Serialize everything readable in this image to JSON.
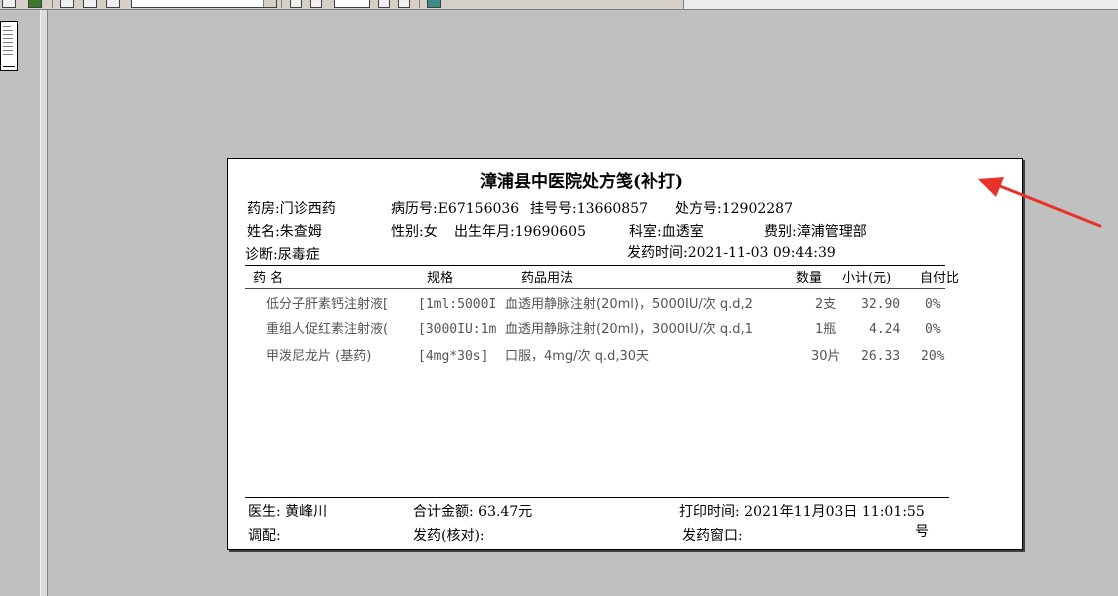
{
  "title": "漳浦县中医院处方笺(补打)",
  "info": {
    "pharmacy": "药房:门诊西药",
    "record_no": "病历号:E67156036",
    "reg_no": "挂号号:13660857",
    "rx_no": "处方号:12902287",
    "name": "姓名:朱查姆",
    "gender": "性别:女",
    "birth": "出生年月:19690605",
    "dept": "科室:血透室",
    "fee_type": "费别:漳浦管理部",
    "diagnosis": "诊断:尿毒症",
    "dispense_time": "发药时间:2021-11-03    09:44:39"
  },
  "table": {
    "headers": {
      "drug": "药    名",
      "spec": "规格",
      "usage": "药品用法",
      "qty": "数量",
      "subtotal": "小计(元)",
      "self_pay": "自付比"
    },
    "rows": [
      {
        "drug": "低分子肝素钙注射液[",
        "spec": "[1ml:5000I",
        "usage": "血透用静脉注射(20ml)，5000IU/次 q.d,2",
        "qty": "2支",
        "subtotal": "32.90",
        "ratio": "0%"
      },
      {
        "drug": "重组人促红素注射液(",
        "spec": "[3000IU:1m",
        "usage": "血透用静脉注射(20ml)，3000IU/次 q.d,1",
        "qty": "1瓶",
        "subtotal": "4.24",
        "ratio": "0%"
      },
      {
        "drug": "甲泼尼龙片 (基药)",
        "spec": "[4mg*30s]",
        "usage": "口服，4mg/次 q.d,30天",
        "qty": "30片",
        "subtotal": "26.33",
        "ratio": "20%"
      }
    ]
  },
  "footer": {
    "doctor": "医生: 黄峰川",
    "total": "合计金额:  63.47元",
    "print_time": "打印时间: 2021年11月03日  11:01:55",
    "prepare": "调配:",
    "dispense_check": "发药(核对):",
    "window": "发药窗口:",
    "window_suffix": "号"
  },
  "colors": {
    "background": "#c0c0c0",
    "arrow": "#e8332a"
  }
}
